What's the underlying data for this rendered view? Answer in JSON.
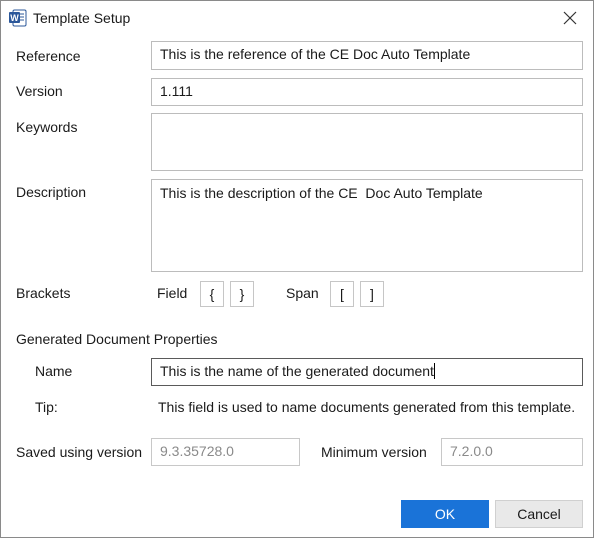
{
  "window": {
    "title": "Template Setup",
    "icon": "word-app-icon",
    "close_icon": "close-icon"
  },
  "fields": {
    "reference": {
      "label": "Reference",
      "value": "This is the reference of the CE Doc Auto Template"
    },
    "version": {
      "label": "Version",
      "value": "1.111"
    },
    "keywords": {
      "label": "Keywords",
      "value": ""
    },
    "description": {
      "label": "Description",
      "value": "This is the description of the CE  Doc Auto Template"
    }
  },
  "brackets": {
    "label": "Brackets",
    "field_label": "Field",
    "field_open": "{",
    "field_close": "}",
    "span_label": "Span",
    "span_open": "[",
    "span_close": "]"
  },
  "generated": {
    "section_title": "Generated Document Properties",
    "name_label": "Name",
    "name_value": "This is the name of the generated document",
    "tip_label": "Tip:",
    "tip_text": "This field is used to name documents generated from this template."
  },
  "versions": {
    "saved_label": "Saved using version",
    "saved_value": "9.3.35728.0",
    "minimum_label": "Minimum version",
    "minimum_value": "7.2.0.0"
  },
  "buttons": {
    "ok": "OK",
    "cancel": "Cancel"
  },
  "colors": {
    "accent": "#1a73d8",
    "word_blue": "#2b579a"
  }
}
